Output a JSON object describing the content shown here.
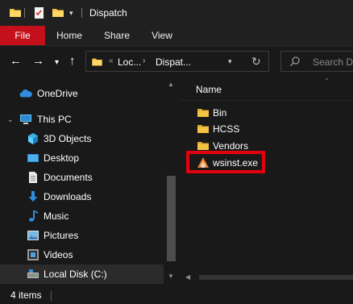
{
  "window": {
    "title": "Dispatch"
  },
  "ribbon": {
    "tabs": [
      {
        "label": "File"
      },
      {
        "label": "Home"
      },
      {
        "label": "Share"
      },
      {
        "label": "View"
      }
    ]
  },
  "addressbar": {
    "crumbs": [
      "Loc...",
      "Dispat..."
    ],
    "overflow_glyph": "«",
    "separator_glyph": "›"
  },
  "search": {
    "placeholder": "Search Di"
  },
  "navpane": {
    "items": [
      {
        "label": "OneDrive",
        "icon": "cloud-icon"
      },
      {
        "label": "This PC",
        "icon": "computer-icon"
      },
      {
        "label": "3D Objects",
        "icon": "cube-icon"
      },
      {
        "label": "Desktop",
        "icon": "desktop-icon"
      },
      {
        "label": "Documents",
        "icon": "document-icon"
      },
      {
        "label": "Downloads",
        "icon": "download-arrow-icon"
      },
      {
        "label": "Music",
        "icon": "music-note-icon"
      },
      {
        "label": "Pictures",
        "icon": "picture-icon"
      },
      {
        "label": "Videos",
        "icon": "film-icon"
      },
      {
        "label": "Local Disk (C:)",
        "icon": "drive-icon"
      }
    ]
  },
  "content": {
    "column_header": "Name",
    "files": [
      {
        "name": "Bin",
        "icon": "folder-icon"
      },
      {
        "name": "HCSS",
        "icon": "folder-icon"
      },
      {
        "name": "Vendors",
        "icon": "folder-icon"
      },
      {
        "name": "wsinst.exe",
        "icon": "installer-icon"
      }
    ]
  },
  "status": {
    "item_count": "4 items"
  },
  "colors": {
    "accent": "#c4101a",
    "highlight_box": "#e4000f",
    "folder": "#f5c342",
    "background": "#191919"
  }
}
